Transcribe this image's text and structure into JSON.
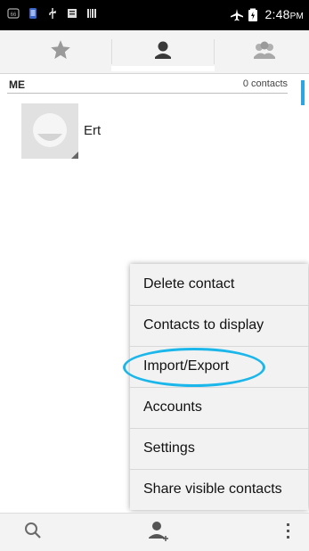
{
  "status_bar": {
    "time": "2:48",
    "ampm": "PM",
    "left_icons": [
      "sd-card-icon",
      "phone-icon",
      "usb-icon",
      "notification-icon",
      "barcode-icon"
    ],
    "right_icons": [
      "airplane-mode-icon",
      "battery-icon"
    ]
  },
  "tabs": [
    {
      "name": "favorites",
      "icon": "star-icon",
      "selected": false
    },
    {
      "name": "contacts",
      "icon": "person-icon",
      "selected": true
    },
    {
      "name": "groups",
      "icon": "group-icon",
      "selected": false
    }
  ],
  "section": {
    "label": "ME",
    "count": "0 contacts"
  },
  "contact": {
    "name": "Ert"
  },
  "menu": {
    "items": [
      "Delete contact",
      "Contacts to display",
      "Import/Export",
      "Accounts",
      "Settings",
      "Share visible contacts"
    ],
    "highlighted": "Import/Export",
    "highlight_color": "#1bb6ea"
  },
  "bottom_bar": {
    "buttons": [
      "search-icon",
      "add-contact-icon",
      "overflow-menu-icon"
    ]
  },
  "colors": {
    "accent": "#2ea5e0",
    "tab_bg": "#f3f3f3",
    "menu_bg": "#f2f2f2"
  }
}
